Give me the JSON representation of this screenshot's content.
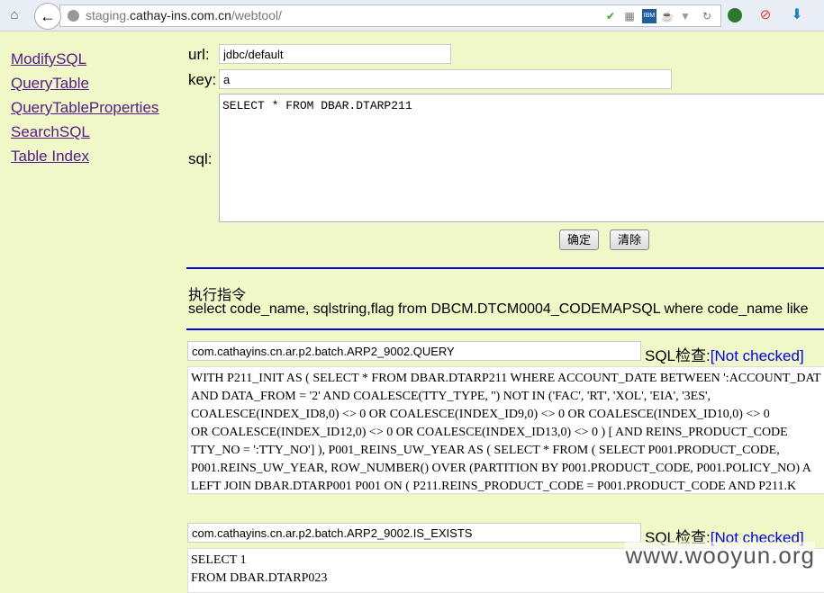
{
  "browser": {
    "url_prefix": "staging.",
    "url_domain": "cathay-ins.com.cn",
    "url_path": "/webtool/"
  },
  "sidebar": {
    "items": [
      {
        "label": "ModifySQL"
      },
      {
        "label": "QueryTable"
      },
      {
        "label": "QueryTableProperties"
      },
      {
        "label": "SearchSQL"
      },
      {
        "label": "Table Index"
      }
    ]
  },
  "form": {
    "url_label": "url:",
    "url_value": "jdbc/default",
    "key_label": "key:",
    "key_value": "a",
    "sql_label": "sql:",
    "sql_value": "SELECT * FROM DBAR.DTARP211",
    "confirm": "确定",
    "clear": "清除"
  },
  "command": {
    "heading": "执行指令",
    "text": "select code_name, sqlstring,flag from DBCM.DTCM0004_CODEMAPSQL where code_name like"
  },
  "results": [
    {
      "name": "com.cathayins.cn.ar.p2.batch.ARP2_9002.QUERY",
      "check_label": "SQL检查:",
      "check_value": "[Not checked]",
      "sql": "WITH P211_INIT AS ( SELECT * FROM DBAR.DTARP211 WHERE ACCOUNT_DATE BETWEEN ':ACCOUNT_DAT\nAND DATA_FROM = '2' AND COALESCE(TTY_TYPE, '') NOT IN ('FAC', 'RT', 'XOL', 'EIA', '3ES',\nCOALESCE(INDEX_ID8,0) <> 0 OR COALESCE(INDEX_ID9,0) <> 0 OR COALESCE(INDEX_ID10,0) <> 0\nOR COALESCE(INDEX_ID12,0) <> 0 OR COALESCE(INDEX_ID13,0) <> 0 ) [ AND REINS_PRODUCT_CODE\nTTY_NO = ':TTY_NO'] ), P001_REINS_UW_YEAR AS ( SELECT * FROM ( SELECT P001.PRODUCT_CODE,\nP001.REINS_UW_YEAR, ROW_NUMBER() OVER (PARTITION BY P001.PRODUCT_CODE, P001.POLICY_NO) A\nLEFT JOIN DBAR.DTARP001 P001 ON ( P211.REINS_PRODUCT_CODE = P001.PRODUCT_CODE AND P211.K"
    },
    {
      "name": "com.cathayins.cn.ar.p2.batch.ARP2_9002.IS_EXISTS",
      "check_label": "SQL检查:",
      "check_value": "[Not checked]",
      "sql": "SELECT 1\nFROM DBAR.DTARP023"
    }
  ],
  "watermark": "www.wooyun.org",
  "colors": {
    "background": "#f0f8c8",
    "link": "#551a8b",
    "rule": "#0000e6",
    "not_checked": "#0000ee"
  }
}
